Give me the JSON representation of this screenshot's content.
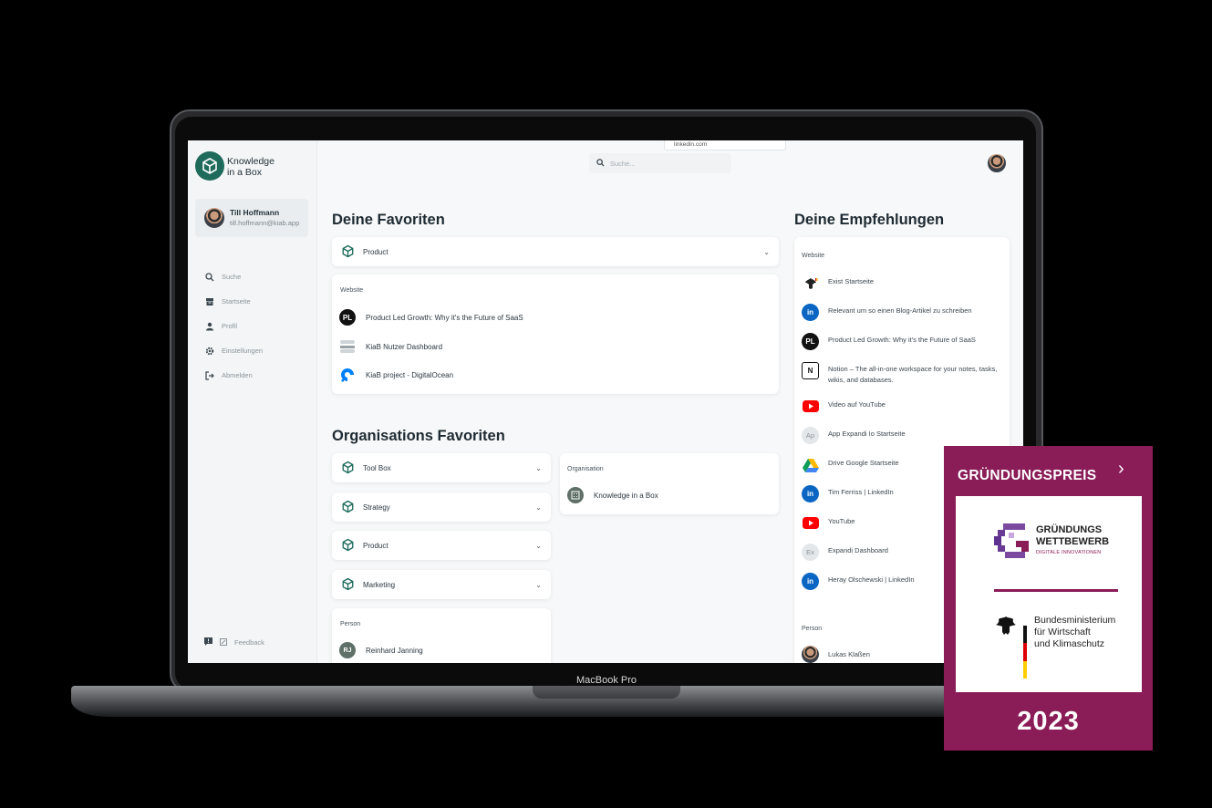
{
  "device": {
    "label": "MacBook Pro"
  },
  "brand": {
    "name": "Knowledge in a Box",
    "line1": "Knowledge",
    "line2": "in a Box",
    "color": "#1e6b5c"
  },
  "user": {
    "name": "Till Hoffmann",
    "email": "till.hoffmann@kiab.app"
  },
  "nav": {
    "items": [
      {
        "label": "Suche",
        "icon": "search-icon"
      },
      {
        "label": "Startseite",
        "icon": "archive-icon"
      },
      {
        "label": "Profil",
        "icon": "person-icon"
      },
      {
        "label": "Einstellungen",
        "icon": "gear-icon"
      },
      {
        "label": "Abmelden",
        "icon": "logout-icon"
      }
    ],
    "feedback": "Feedback"
  },
  "search": {
    "placeholder": "Suche...",
    "dropdown_hint": "linkedin.com"
  },
  "favorites": {
    "title": "Deine Favoriten",
    "collection": "Product",
    "group_label": "Website",
    "items": [
      {
        "label": "Product Led Growth: Why it's the Future of SaaS",
        "icon": "pl-icon"
      },
      {
        "label": "KiaB Nutzer Dashboard",
        "icon": "kiab-icon"
      },
      {
        "label": "KiaB project - DigitalOcean",
        "icon": "digitalocean-icon"
      }
    ]
  },
  "org_favorites": {
    "title": "Organisations Favoriten",
    "collections": [
      "Tool Box",
      "Strategy",
      "Product",
      "Marketing"
    ],
    "organisation_label": "Organisation",
    "organisation": "Knowledge in a Box",
    "person_label": "Person",
    "person": "Reinhard Janning",
    "person_initials": "RJ"
  },
  "recommendations": {
    "title": "Deine Empfehlungen",
    "website_label": "Website",
    "items": [
      {
        "label": "Exist Startseite",
        "icon": "eagle-icon"
      },
      {
        "label": "Relevant um so einen Blog-Artikel zu schreiben",
        "icon": "linkedin-icon"
      },
      {
        "label": "Product Led Growth: Why it's the Future of SaaS",
        "icon": "pl-icon"
      },
      {
        "label": "Notion – The all-in-one workspace for your notes, tasks, wikis, and databases.",
        "icon": "notion-icon"
      },
      {
        "label": "Video auf YouTube",
        "icon": "youtube-icon"
      },
      {
        "label": "App Expandi Io Startseite",
        "icon": "ap-icon",
        "initials": "Ap"
      },
      {
        "label": "Drive Google Startseite",
        "icon": "google-drive-icon"
      },
      {
        "label": "Tim Ferriss | LinkedIn",
        "icon": "linkedin-icon"
      },
      {
        "label": "YouTube",
        "icon": "youtube-icon"
      },
      {
        "label": "Expandi Dashboard",
        "icon": "ex-icon",
        "initials": "Ex"
      },
      {
        "label": "Heray Olschewski | LinkedIn",
        "icon": "linkedin-icon"
      }
    ],
    "person_label": "Person",
    "person": "Lukas Klaßen"
  },
  "badge": {
    "title": "GRÜNDUNGSPREIS",
    "contest_line1": "GRÜNDUNGS",
    "contest_line2": "WETTBEWERB",
    "contest_sub": "DIGITALE INNOVATIONEN",
    "ministry_line1": "Bundesministerium",
    "ministry_line2": "für Wirtschaft",
    "ministry_line3": "und Klimaschutz",
    "year": "2023",
    "color": "#8a1c57"
  }
}
